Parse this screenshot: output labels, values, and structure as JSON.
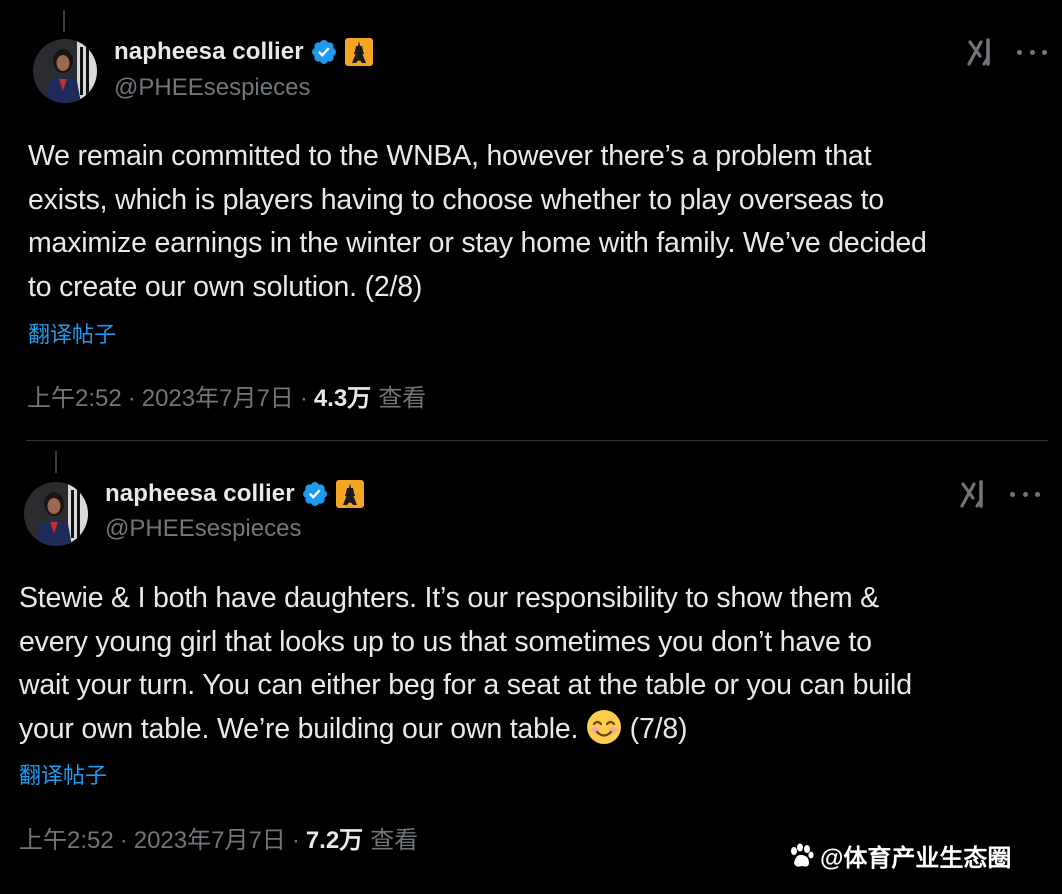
{
  "colors": {
    "background": "#000000",
    "text_primary": "#e7e9ea",
    "text_secondary": "#71767b",
    "link": "#1d9bf0",
    "verified": "#1d9bf0",
    "badge": "#f5a524",
    "divider": "#2f3336"
  },
  "tweets": [
    {
      "author": {
        "name": "napheesa collier",
        "handle": "@PHEEsespieces",
        "verified_icon": "verified-badge-icon",
        "affiliate_badge_icon": "eiffel-tower-icon"
      },
      "text": "We remain committed to the WNBA, however there’s a problem that\nexists, which is players having to choose whether to play overseas to\nmaximize earnings in the winter or stay home with family. We’ve decided\nto create our own solution. (2/8)",
      "translate_label": "翻译帖子",
      "time": "上午2:52",
      "separator": "·",
      "date": "2023年7月7日",
      "views_count": "4.3万",
      "views_label": "查看"
    },
    {
      "author": {
        "name": "napheesa collier",
        "handle": "@PHEEsespieces",
        "verified_icon": "verified-badge-icon",
        "affiliate_badge_icon": "eiffel-tower-icon"
      },
      "text_before_emoji": "Stewie & I both have daughters. It’s our responsibility to show them &\nevery young girl that looks up to us that sometimes you don’t have to\nwait your turn. You can either beg for a seat at the table or you can build\nyour own table. We’re building our own table. ",
      "text_after_emoji": " (7/8)",
      "emoji_icon": "smiling-face-with-smiling-eyes-emoji",
      "translate_label": "翻译帖子",
      "time": "上午2:52",
      "separator": "·",
      "date": "2023年7月7日",
      "views_count": "7.2万",
      "views_label": "查看"
    }
  ],
  "watermark": {
    "text": "@体育产业生态圈",
    "icon": "paw-icon"
  }
}
